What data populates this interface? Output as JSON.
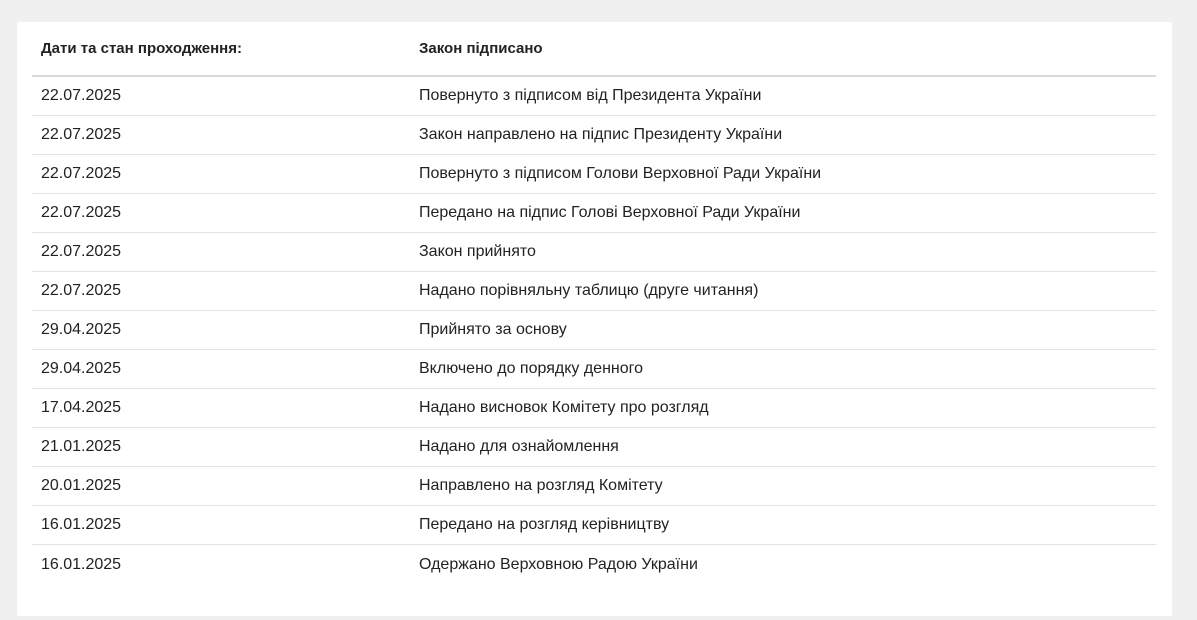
{
  "table": {
    "header": {
      "date_label": "Дати та стан проходження:",
      "status_label": "Закон підписано"
    },
    "rows": [
      {
        "date": "22.07.2025",
        "status": "Повернуто з підписом від Президента України"
      },
      {
        "date": "22.07.2025",
        "status": "Закон направлено на підпис Президенту України"
      },
      {
        "date": "22.07.2025",
        "status": "Повернуто з підписом Голови Верховної Ради України"
      },
      {
        "date": "22.07.2025",
        "status": "Передано на підпис Голові Верховної Ради України"
      },
      {
        "date": "22.07.2025",
        "status": "Закон прийнято"
      },
      {
        "date": "22.07.2025",
        "status": "Надано порівняльну таблицю (друге читання)"
      },
      {
        "date": "29.04.2025",
        "status": "Прийнято за основу"
      },
      {
        "date": "29.04.2025",
        "status": "Включено до порядку денного"
      },
      {
        "date": "17.04.2025",
        "status": "Надано висновок Комітету про розгляд"
      },
      {
        "date": "21.01.2025",
        "status": "Надано для ознайомлення"
      },
      {
        "date": "20.01.2025",
        "status": "Направлено на розгляд Комітету"
      },
      {
        "date": "16.01.2025",
        "status": "Передано на розгляд керівництву"
      },
      {
        "date": "16.01.2025",
        "status": "Одержано Верховною Радою України"
      }
    ]
  }
}
